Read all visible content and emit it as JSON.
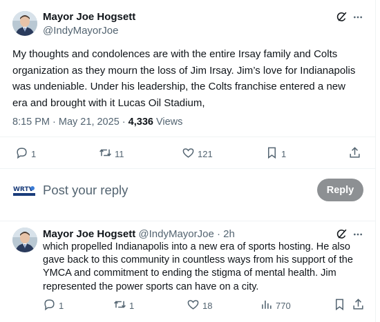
{
  "main_tweet": {
    "author_name": "Mayor Joe Hogsett",
    "author_handle": "@IndyMayorJoe",
    "text": "My thoughts and condolences are with the entire Irsay family and Colts organization as they mourn the loss of Jim Irsay. Jim’s love for Indianapolis was undeniable. Under his leadership, the Colts franchise entered a new era and brought with it Lucas Oil Stadium,",
    "time": "8:15 PM",
    "date": "May 21, 2025",
    "views_count": "4,336",
    "views_label": "Views",
    "replies": "1",
    "reposts": "11",
    "likes": "121",
    "bookmarks": "1"
  },
  "composer": {
    "logo_text": "WRTV",
    "placeholder": "Post your reply",
    "reply_button": "Reply"
  },
  "reply_tweet": {
    "author_name": "Mayor Joe Hogsett",
    "author_handle": "@IndyMayorJoe",
    "separator": "·",
    "time_ago": "2h",
    "text": "which propelled Indianapolis into a new era of sports hosting. He also gave back to this community in countless ways from his support of the YMCA and commitment to ending the stigma of mental health. Jim represented the power sports can have on a city.",
    "replies": "1",
    "reposts": "1",
    "likes": "18",
    "views": "770"
  },
  "colors": {
    "text_primary": "#0f1419",
    "text_secondary": "#536471",
    "divider": "#eff3f4",
    "reply_button_bg": "#8d9093"
  },
  "icons": [
    "grok-icon",
    "more-icon",
    "reply-icon",
    "repost-icon",
    "like-icon",
    "bookmark-icon",
    "share-icon",
    "views-icon"
  ]
}
